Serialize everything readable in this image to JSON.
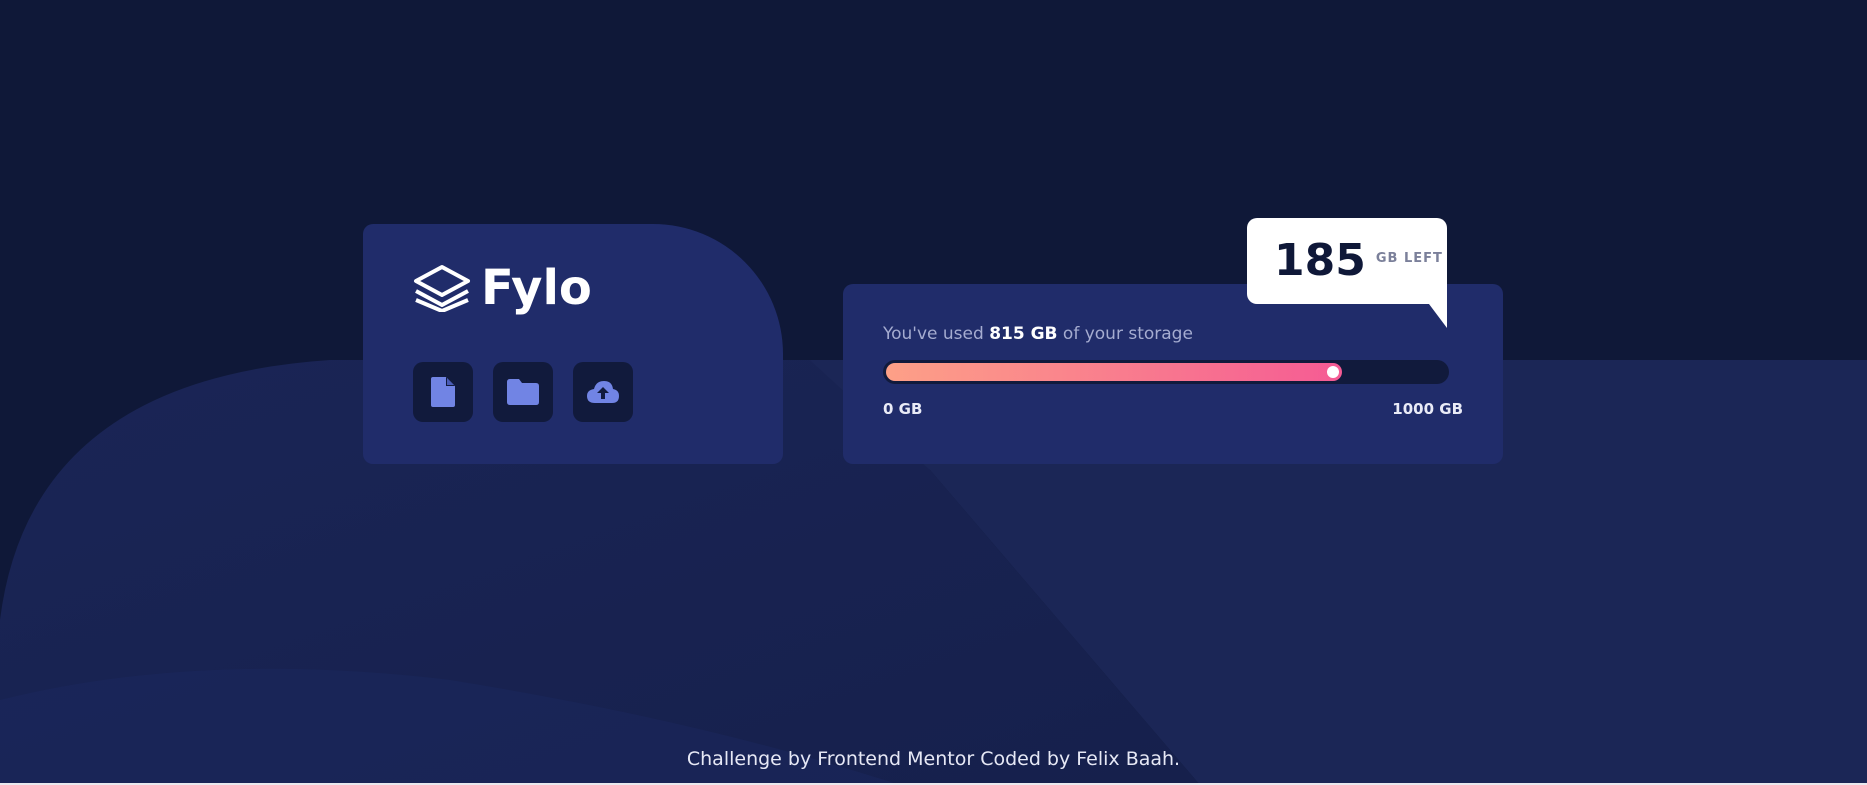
{
  "brand": {
    "name": "Fylo",
    "logo_icon": "layers-icon"
  },
  "toolbar": {
    "buttons": [
      {
        "icon": "document-icon"
      },
      {
        "icon": "folder-icon"
      },
      {
        "icon": "cloud-upload-icon"
      }
    ]
  },
  "storage": {
    "used_prefix": "You've used",
    "used_amount": "815 GB",
    "used_suffix": "of your storage",
    "used_fraction": 0.815,
    "scale_min": "0 GB",
    "scale_max": "1000 GB",
    "remaining_value": "185",
    "remaining_unit": "GB LEFT"
  },
  "footer": {
    "text": "Challenge by Frontend Mentor Coded by Felix Baah."
  },
  "colors": {
    "background": "#0f1838",
    "card": "#202c6a",
    "icon_tint": "#7184e4",
    "gradient_start": "#fda087",
    "gradient_end": "#f55b94",
    "bubble": "#ffffff"
  }
}
